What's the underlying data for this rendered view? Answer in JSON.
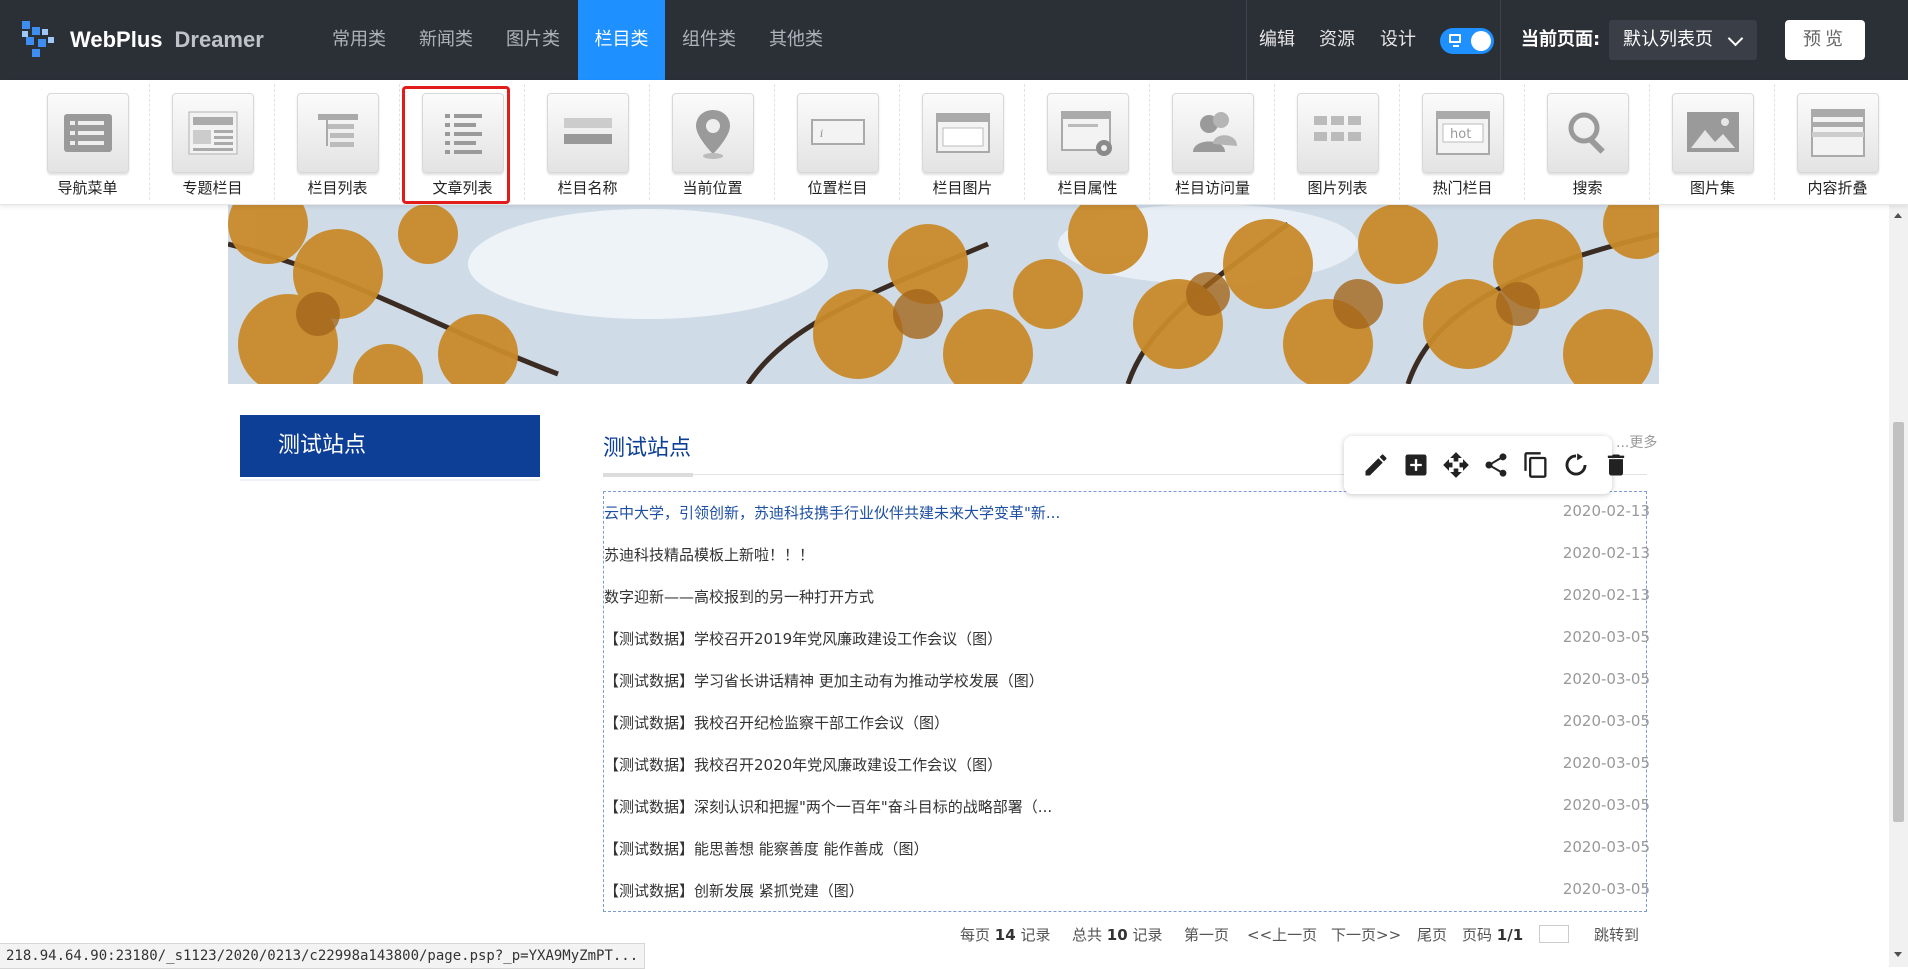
{
  "app": {
    "logo_main": "WebPlus",
    "logo_sub": "Dreamer"
  },
  "top_tabs": [
    {
      "label": "常用类",
      "active": false
    },
    {
      "label": "新闻类",
      "active": false
    },
    {
      "label": "图片类",
      "active": false
    },
    {
      "label": "栏目类",
      "active": true
    },
    {
      "label": "组件类",
      "active": false
    },
    {
      "label": "其他类",
      "active": false
    }
  ],
  "top_links": {
    "edit": "编辑",
    "resources": "资源",
    "design": "设计"
  },
  "mode_toggle": {
    "icon": "monitor-icon",
    "on": true
  },
  "current_page": {
    "label": "当前页面:",
    "value": "默认列表页"
  },
  "preview_label": "预览",
  "components": [
    {
      "label": "导航菜单",
      "icon": "nav-menu-icon"
    },
    {
      "label": "专题栏目",
      "icon": "topic-column-icon"
    },
    {
      "label": "栏目列表",
      "icon": "column-list-icon"
    },
    {
      "label": "文章列表",
      "icon": "article-list-icon",
      "selected": true
    },
    {
      "label": "栏目名称",
      "icon": "column-name-icon"
    },
    {
      "label": "当前位置",
      "icon": "location-pin-icon"
    },
    {
      "label": "位置栏目",
      "icon": "position-column-icon"
    },
    {
      "label": "栏目图片",
      "icon": "column-image-icon"
    },
    {
      "label": "栏目属性",
      "icon": "column-settings-icon"
    },
    {
      "label": "栏目访问量",
      "icon": "column-visits-icon"
    },
    {
      "label": "图片列表",
      "icon": "image-list-icon"
    },
    {
      "label": "热门栏目",
      "icon": "hot-column-icon"
    },
    {
      "label": "搜索",
      "icon": "search-icon"
    },
    {
      "label": "图片集",
      "icon": "gallery-icon"
    },
    {
      "label": "内容折叠",
      "icon": "content-collapse-icon"
    }
  ],
  "sidebar": {
    "title": "测试站点"
  },
  "main": {
    "title": "测试站点",
    "more": "...更多",
    "articles": [
      {
        "title": "云中大学，引领创新，苏迪科技携手行业伙伴共建未来大学变革\"新...",
        "date": "2020-02-13"
      },
      {
        "title": "苏迪科技精品模板上新啦！！！",
        "date": "2020-02-13"
      },
      {
        "title": "数字迎新——高校报到的另一种打开方式",
        "date": "2020-02-13"
      },
      {
        "title": "【测试数据】学校召开2019年党风廉政建设工作会议（图）",
        "date": "2020-03-05"
      },
      {
        "title": "【测试数据】学习省长讲话精神 更加主动有为推动学校发展（图）",
        "date": "2020-03-05"
      },
      {
        "title": "【测试数据】我校召开纪检监察干部工作会议（图）",
        "date": "2020-03-05"
      },
      {
        "title": "【测试数据】我校召开2020年党风廉政建设工作会议（图）",
        "date": "2020-03-05"
      },
      {
        "title": "【测试数据】深刻认识和把握\"两个一百年\"奋斗目标的战略部署（...",
        "date": "2020-03-05"
      },
      {
        "title": "【测试数据】能思善想 能察善度 能作善成（图）",
        "date": "2020-03-05"
      },
      {
        "title": "【测试数据】创新发展 紧抓党建（图）",
        "date": "2020-03-05"
      }
    ]
  },
  "element_actions": [
    "edit-icon",
    "add-icon",
    "move-icon",
    "share-icon",
    "copy-icon",
    "refresh-icon",
    "delete-icon"
  ],
  "pager": {
    "per_page_prefix": "每页",
    "per_page": "14",
    "per_page_suffix": "记录",
    "total_prefix": "总共",
    "total": "10",
    "total_suffix": "记录",
    "first": "第一页",
    "prev": "<<上一页",
    "next": "下一页>>",
    "last": "尾页",
    "page_prefix": "页码",
    "page": "1/1",
    "goto": "跳转到"
  },
  "status_url": "218.94.64.90:23180/_s1123/2020/0213/c22998a143800/page.psp?_p=YXA9MyZmPT..."
}
